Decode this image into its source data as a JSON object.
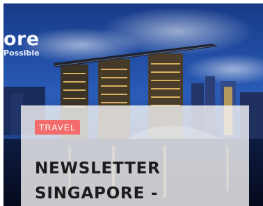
{
  "hero": {
    "brand_word": "ore",
    "brand_tagline": "Possible"
  },
  "post": {
    "category": "TRAVEL",
    "title_line1": "NEWSLETTER",
    "title_line2": "SINGAPORE -"
  },
  "colors": {
    "badge": "#f36b6b",
    "sky": "#1b3f8f",
    "water": "#0a1533",
    "title": "#1c1c1c"
  }
}
